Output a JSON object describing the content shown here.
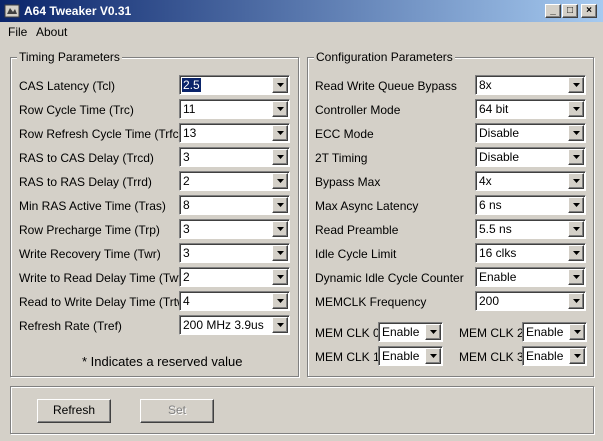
{
  "window": {
    "title": "A64 Tweaker V0.31",
    "controls": {
      "minimize": "_",
      "maximize": "□",
      "close": "×"
    }
  },
  "menu": [
    "File",
    "About"
  ],
  "timing": {
    "title": "Timing Parameters",
    "rows": [
      {
        "label": "CAS Latency (Tcl)",
        "value": "2.5"
      },
      {
        "label": "Row Cycle Time (Trc)",
        "value": "11"
      },
      {
        "label": "Row Refresh Cycle Time (Trfc)",
        "value": "13"
      },
      {
        "label": "RAS to CAS Delay (Trcd)",
        "value": "3"
      },
      {
        "label": "RAS to RAS Delay (Trrd)",
        "value": "2"
      },
      {
        "label": "Min RAS Active Time (Tras)",
        "value": "8"
      },
      {
        "label": "Row Precharge Time (Trp)",
        "value": "3"
      },
      {
        "label": "Write Recovery Time (Twr)",
        "value": "3"
      },
      {
        "label": "Write to Read Delay Time (Twtr)",
        "value": "2"
      },
      {
        "label": "Read to Write Delay Time (Trtw)",
        "value": "4"
      },
      {
        "label": "Refresh Rate (Tref)",
        "value": "200 MHz 3.9us"
      }
    ],
    "note": "* Indicates a reserved value"
  },
  "config": {
    "title": "Configuration Parameters",
    "rows": [
      {
        "label": "Read Write Queue Bypass",
        "value": "8x"
      },
      {
        "label": "Controller Mode",
        "value": "64 bit"
      },
      {
        "label": "ECC Mode",
        "value": "Disable"
      },
      {
        "label": "2T Timing",
        "value": "Disable"
      },
      {
        "label": "Bypass Max",
        "value": "4x"
      },
      {
        "label": "Max Async Latency",
        "value": "6 ns"
      },
      {
        "label": "Read Preamble",
        "value": "5.5 ns"
      },
      {
        "label": "Idle Cycle Limit",
        "value": "16 clks"
      },
      {
        "label": "Dynamic Idle Cycle Counter",
        "value": "Enable"
      },
      {
        "label": "MEMCLK Frequency",
        "value": "200"
      }
    ],
    "memclk": [
      {
        "label": "MEM CLK 0",
        "value": "Enable"
      },
      {
        "label": "MEM CLK 2",
        "value": "Enable"
      },
      {
        "label": "MEM CLK 1",
        "value": "Enable"
      },
      {
        "label": "MEM CLK 3",
        "value": "Enable"
      }
    ]
  },
  "buttons": {
    "refresh": "Refresh",
    "set": "Set"
  },
  "colors": {
    "titlebar_start": "#0a246a",
    "titlebar_end": "#a6caf0",
    "face": "#d4d0c8",
    "selection": "#0a246a"
  }
}
